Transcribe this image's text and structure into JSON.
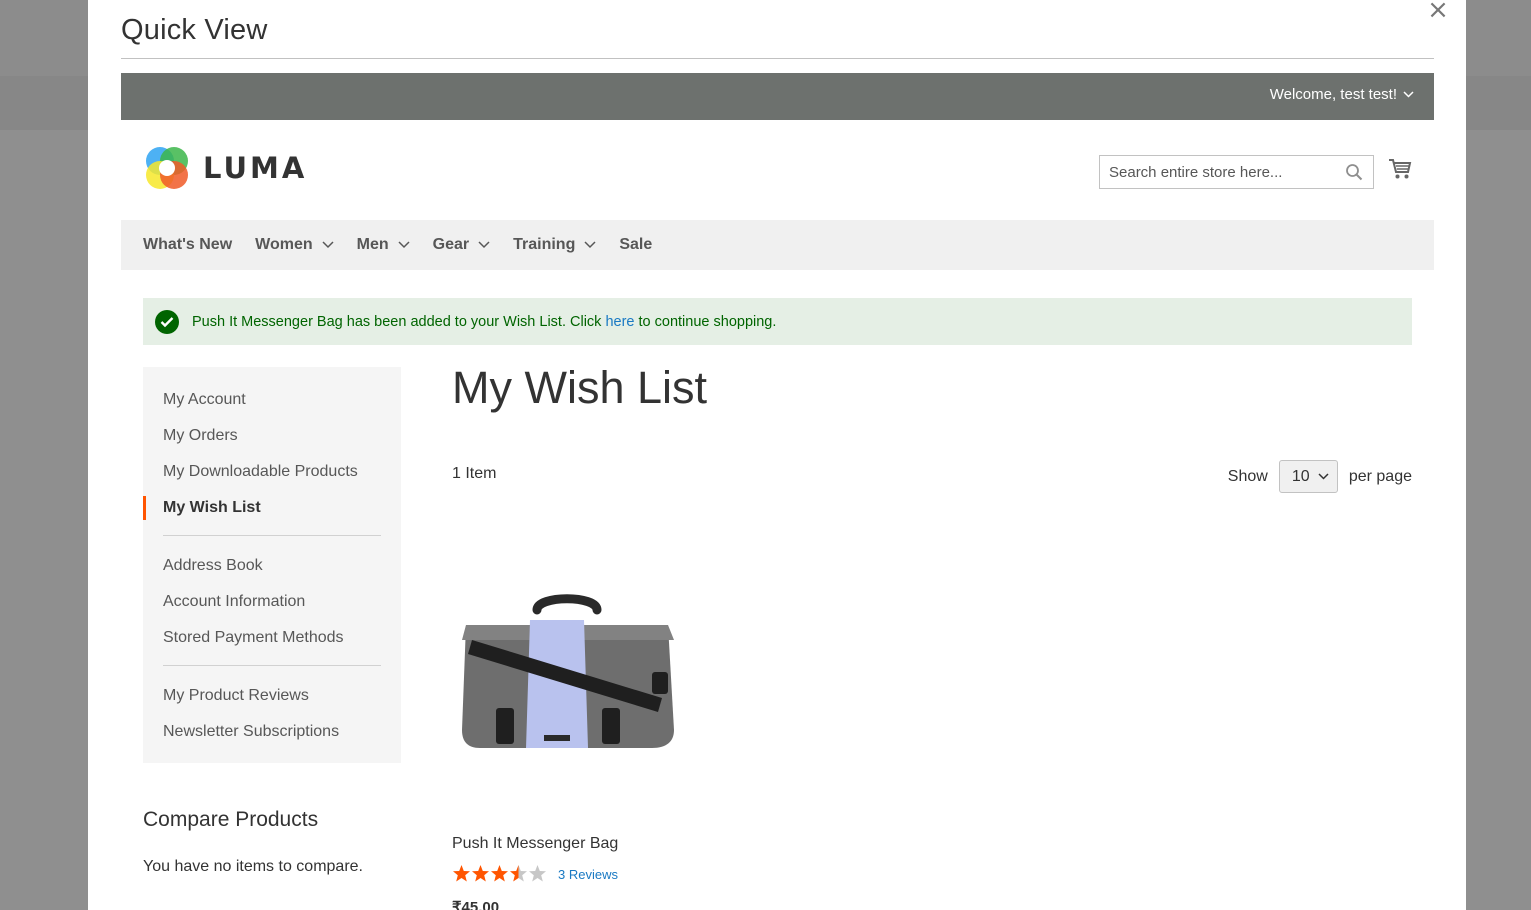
{
  "modal": {
    "title": "Quick View",
    "close_symbol": "×"
  },
  "header": {
    "welcome": "Welcome, test test!"
  },
  "logo": {
    "text": "LUMA"
  },
  "search": {
    "placeholder": "Search entire store here..."
  },
  "nav": {
    "items": [
      {
        "label": "What's New",
        "has_dropdown": false
      },
      {
        "label": "Women",
        "has_dropdown": true
      },
      {
        "label": "Men",
        "has_dropdown": true
      },
      {
        "label": "Gear",
        "has_dropdown": true
      },
      {
        "label": "Training",
        "has_dropdown": true
      },
      {
        "label": "Sale",
        "has_dropdown": false
      }
    ]
  },
  "message": {
    "before_link": "Push It Messenger Bag has been added to your Wish List. Click ",
    "link": "here",
    "after_link": " to continue shopping."
  },
  "sidebar": {
    "group1": [
      "My Account",
      "My Orders",
      "My Downloadable Products",
      "My Wish List"
    ],
    "active": "My Wish List",
    "group2": [
      "Address Book",
      "Account Information",
      "Stored Payment Methods"
    ],
    "group3": [
      "My Product Reviews",
      "Newsletter Subscriptions"
    ]
  },
  "compare": {
    "title": "Compare Products",
    "empty": "You have no items to compare."
  },
  "main": {
    "title": "My Wish List",
    "item_count": "1 Item",
    "show_label": "Show",
    "per_page_value": "10",
    "per_page_label": "per page"
  },
  "product": {
    "name": "Push It Messenger Bag",
    "rating_out_of_5": 3.5,
    "reviews": "3 Reviews",
    "price": "₹45.00"
  },
  "colors": {
    "accent": "#ff5501",
    "link": "#1979c3",
    "success": "#006400",
    "header_bg": "#6d716e",
    "star_filled": "#ff5501",
    "star_empty": "#c7c7c7"
  }
}
